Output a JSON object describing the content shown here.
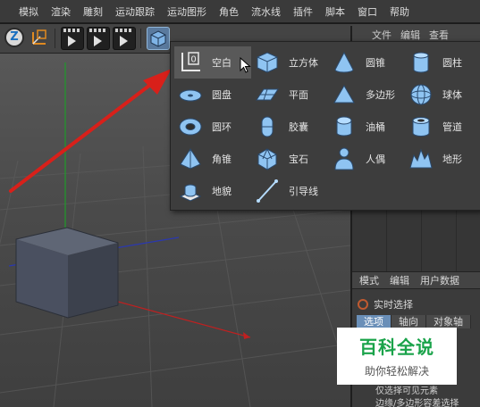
{
  "menubar": {
    "items": [
      "模拟",
      "渲染",
      "雕刻",
      "运动跟踪",
      "运动图形",
      "角色",
      "流水线",
      "插件",
      "脚本",
      "窗口",
      "帮助"
    ]
  },
  "right_panel": {
    "tabs": [
      "文件",
      "编辑",
      "查看"
    ],
    "attr_tabs": [
      "模式",
      "编辑",
      "用户数据"
    ],
    "live_select": "实时选择",
    "sub_tabs": [
      "选项",
      "轴向",
      "对象轴"
    ],
    "options_text": "仅选择可见元素",
    "options_text2": "边缘/多边形容差选择"
  },
  "popup": {
    "items": [
      {
        "label": "空白",
        "icon": "null-icon",
        "highlighted": true
      },
      {
        "label": "立方体",
        "icon": "cube-icon"
      },
      {
        "label": "圆锥",
        "icon": "cone-icon"
      },
      {
        "label": "圆柱",
        "icon": "cylinder-icon"
      },
      {
        "label": "圆盘",
        "icon": "disc-icon"
      },
      {
        "label": "平面",
        "icon": "plane-icon"
      },
      {
        "label": "多边形",
        "icon": "polygon-icon"
      },
      {
        "label": "球体",
        "icon": "sphere-icon"
      },
      {
        "label": "圆环",
        "icon": "torus-icon"
      },
      {
        "label": "胶囊",
        "icon": "capsule-icon"
      },
      {
        "label": "油桶",
        "icon": "oil-tank-icon"
      },
      {
        "label": "管道",
        "icon": "tube-icon"
      },
      {
        "label": "角锥",
        "icon": "pyramid-icon"
      },
      {
        "label": "宝石",
        "icon": "platonic-icon"
      },
      {
        "label": "人偶",
        "icon": "figure-icon"
      },
      {
        "label": "地形",
        "icon": "landscape-icon"
      },
      {
        "label": "地貌",
        "icon": "relief-icon"
      },
      {
        "label": "引导线",
        "icon": "guide-icon"
      }
    ]
  },
  "toolbar": {
    "icons": [
      "z-axis-icon",
      "coordinate-icon",
      "render-view-icon",
      "render-picture-icon",
      "render-settings-icon",
      "cube-primitive-icon"
    ]
  },
  "watermark": {
    "title": "百科全说",
    "subtitle": "助你轻松解决"
  },
  "colors": {
    "accent": "#6a8fb8",
    "arrow": "#d8201a",
    "y_axis": "#1f9a2a",
    "x_axis": "#c02020",
    "z_axis": "#3040c0"
  }
}
